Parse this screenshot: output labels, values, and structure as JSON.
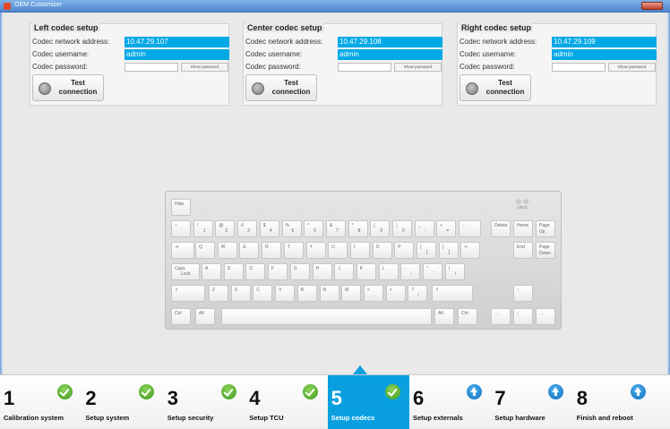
{
  "window": {
    "title": "OEM Customizer"
  },
  "panels": [
    {
      "title": "Left codec setup",
      "address_label": "Codec network address:",
      "address": "10.47.29.107",
      "username_label": "Codec username:",
      "username": "admin",
      "password_label": "Codec password:",
      "show_password": "Show password",
      "test_button": "Test connection"
    },
    {
      "title": "Center codec setup",
      "address_label": "Codec network address:",
      "address": "10.47.29.108",
      "username_label": "Codec username:",
      "username": "admin",
      "password_label": "Codec password:",
      "show_password": "Show password",
      "test_button": "Test connection"
    },
    {
      "title": "Right codec setup",
      "address_label": "Codec network address:",
      "address": "10.47.29.109",
      "username_label": "Codec username:",
      "username": "admin",
      "password_label": "Codec password:",
      "show_password": "Show password",
      "test_button": "Test connection"
    }
  ],
  "keyboard": {
    "hide_label": "Hide",
    "logo": "cisco",
    "row1": [
      {
        "top": "~",
        "bot": "`"
      },
      {
        "top": "!",
        "bot": "1"
      },
      {
        "top": "@",
        "bot": "2"
      },
      {
        "top": "#",
        "bot": "3"
      },
      {
        "top": "$",
        "bot": "4"
      },
      {
        "top": "%",
        "bot": "5"
      },
      {
        "top": "^",
        "bot": "6"
      },
      {
        "top": "&",
        "bot": "7"
      },
      {
        "top": "*",
        "bot": "8"
      },
      {
        "top": "(",
        "bot": "9"
      },
      {
        "top": ")",
        "bot": "0"
      },
      {
        "top": "_",
        "bot": "-"
      },
      {
        "top": "+",
        "bot": "="
      },
      {
        "top": "←",
        "bot": ""
      }
    ],
    "row2": [
      {
        "top": "⇥",
        "bot": ""
      },
      {
        "top": "Q",
        "bot": ""
      },
      {
        "top": "W",
        "bot": ""
      },
      {
        "top": "E",
        "bot": ""
      },
      {
        "top": "R",
        "bot": ""
      },
      {
        "top": "T",
        "bot": ""
      },
      {
        "top": "Y",
        "bot": ""
      },
      {
        "top": "U",
        "bot": ""
      },
      {
        "top": "I",
        "bot": ""
      },
      {
        "top": "O",
        "bot": ""
      },
      {
        "top": "P",
        "bot": ""
      },
      {
        "top": "{",
        "bot": "["
      },
      {
        "top": "}",
        "bot": "]"
      },
      {
        "top": "↵",
        "bot": ""
      }
    ],
    "row3": [
      {
        "top": "Caps",
        "bot": "Lock"
      },
      {
        "top": "A",
        "bot": ""
      },
      {
        "top": "S",
        "bot": ""
      },
      {
        "top": "D",
        "bot": ""
      },
      {
        "top": "F",
        "bot": ""
      },
      {
        "top": "G",
        "bot": ""
      },
      {
        "top": "H",
        "bot": ""
      },
      {
        "top": "J",
        "bot": ""
      },
      {
        "top": "K",
        "bot": ""
      },
      {
        "top": "L",
        "bot": ""
      },
      {
        "top": ":",
        "bot": ";"
      },
      {
        "top": "\"",
        "bot": "'"
      },
      {
        "top": "|",
        "bot": "\\"
      }
    ],
    "row4": [
      {
        "top": "⇧",
        "bot": ""
      },
      {
        "top": "Z",
        "bot": ""
      },
      {
        "top": "X",
        "bot": ""
      },
      {
        "top": "C",
        "bot": ""
      },
      {
        "top": "V",
        "bot": ""
      },
      {
        "top": "B",
        "bot": ""
      },
      {
        "top": "N",
        "bot": ""
      },
      {
        "top": "M",
        "bot": ""
      },
      {
        "top": "<",
        "bot": ","
      },
      {
        "top": ">",
        "bot": "."
      },
      {
        "top": "?",
        "bot": "/"
      },
      {
        "top": "⇧",
        "bot": ""
      }
    ],
    "row5": {
      "ctrl_l": "Ctrl",
      "alt_l": "Alt",
      "alt_r": "Alt",
      "ctrl_r": "Ctrl"
    },
    "nav": {
      "delete": "Delete",
      "home": "Home",
      "pgup": "Page Up",
      "end": "End",
      "pgdn": "Page Down",
      "up": "↑",
      "left": "←",
      "down": "↓",
      "right": "→"
    }
  },
  "steps": [
    {
      "num": "1",
      "label": "Calibration system",
      "status": "done"
    },
    {
      "num": "2",
      "label": "Setup system",
      "status": "done"
    },
    {
      "num": "3",
      "label": "Setup security",
      "status": "done"
    },
    {
      "num": "4",
      "label": "Setup TCU",
      "status": "done"
    },
    {
      "num": "5",
      "label": "Setup codecs",
      "status": "done"
    },
    {
      "num": "6",
      "label": "Setup externals",
      "status": "pending"
    },
    {
      "num": "7",
      "label": "Setup hardware",
      "status": "pending"
    },
    {
      "num": "8",
      "label": "Finish and reboot",
      "status": "pending"
    }
  ],
  "active_step": "5",
  "colors": {
    "accent": "#0aa0e0",
    "field": "#00a8e6",
    "check": "#3b9a1f",
    "pending": "#0e6fbf"
  }
}
